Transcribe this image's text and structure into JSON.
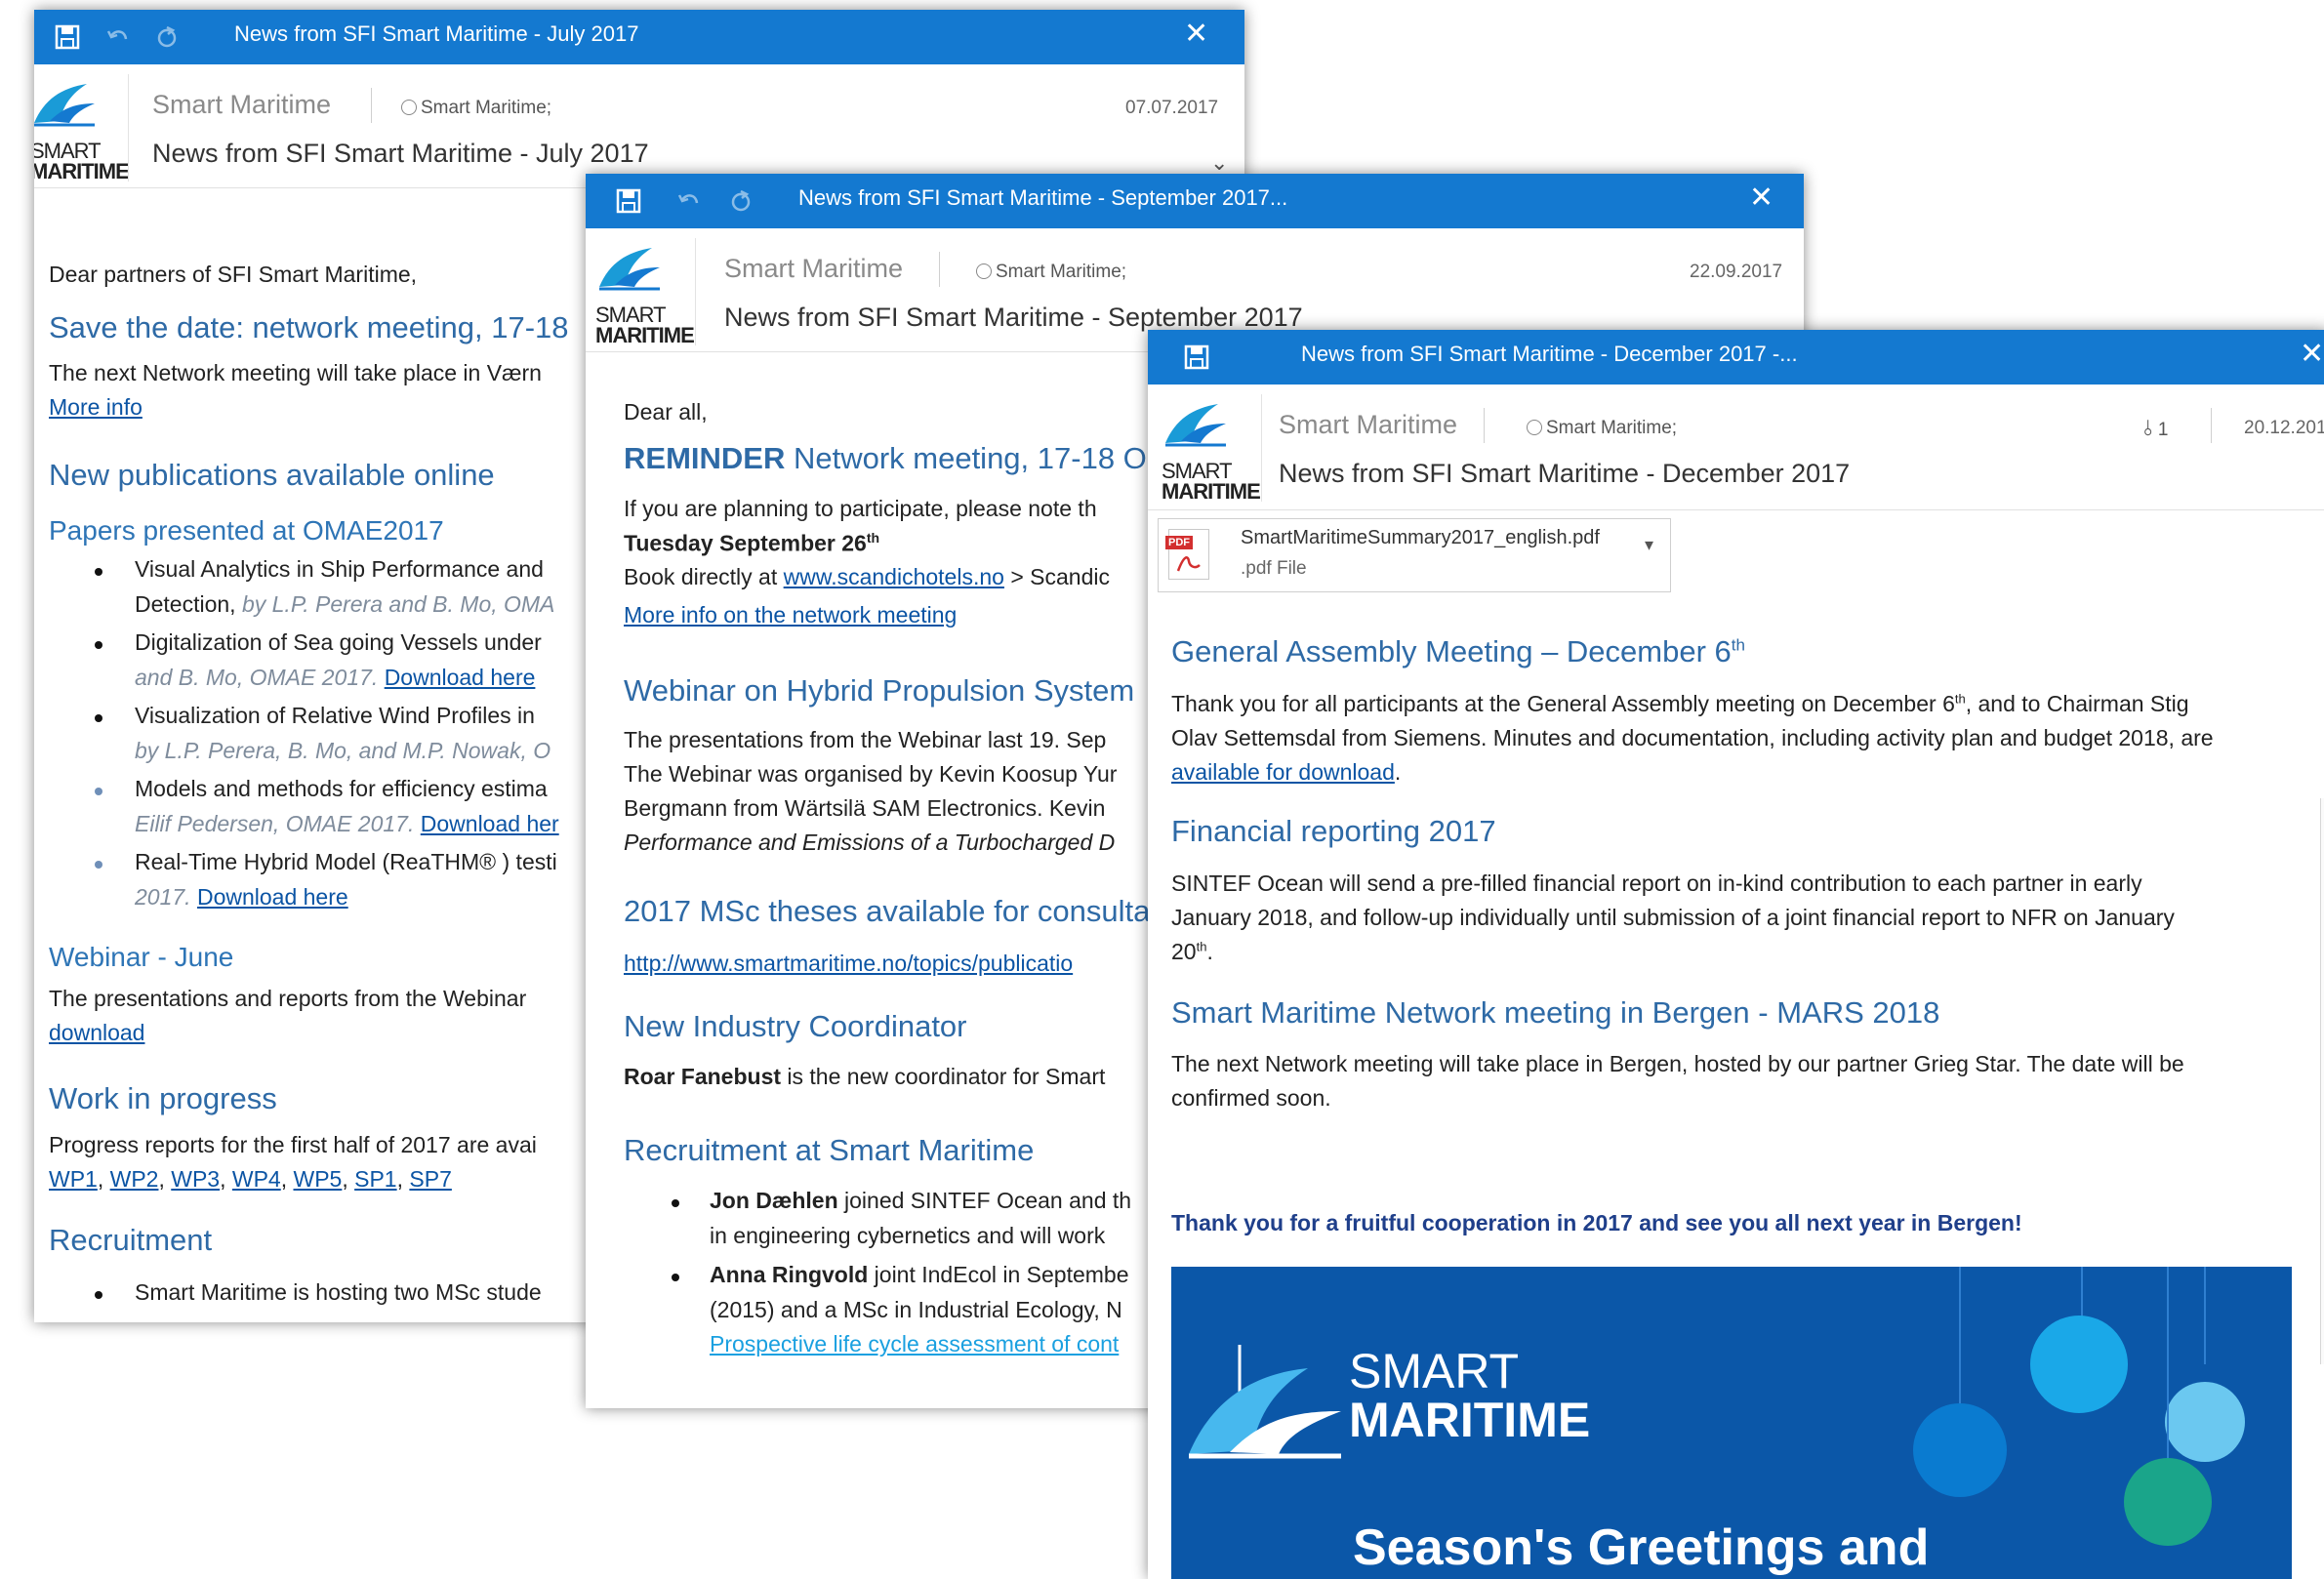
{
  "logo": {
    "line1": "SMART",
    "line2": "MARITIME"
  },
  "july": {
    "title": "News from SFI Smart Maritime - July 2017",
    "sender": "Smart Maritime",
    "to": "Smart Maritime;",
    "date": "07.07.2017",
    "subject": "News from SFI Smart Maritime - July 2017",
    "greeting": "Dear partners of SFI Smart Maritime,",
    "h_save": "Save the date: network meeting, 17-18",
    "save_text": "The next Network meeting will take place in Værn",
    "more_info": "More info",
    "h_pubs": "New publications available online",
    "h_papers": "Papers presented at OMAE2017",
    "pub1_l1": "Visual Analytics in Ship Performance and",
    "pub1_l2": "Detection,",
    "pub1_l2b": " by L.P. Perera and B. Mo, OMA",
    "pub2_l1": "Digitalization of Sea going Vessels under",
    "pub2_l2": "and B. Mo, OMAE 2017.",
    "pub3_l1": "Visualization of Relative Wind Profiles in",
    "pub3_l2": "by L.P. Perera, B. Mo, and M.P. Nowak, O",
    "pub4_l1": "Models and methods for efficiency estima",
    "pub4_l2": "Eilif Pedersen, OMAE 2017.",
    "pub5_l1": "Real-Time Hybrid Model (ReaTHM® ) testi",
    "pub5_l2": "2017.",
    "download_here": "Download here",
    "download_her": "Download her",
    "h_webinar": "Webinar - June",
    "webinar_text": "The presentations and reports from the Webinar",
    "download": "download",
    "h_work": "Work in progress",
    "work_text": "Progress reports for the first half of 2017 are avai",
    "wp_links": [
      "WP1",
      "WP2",
      "WP3",
      "WP4",
      "WP5",
      "SP1",
      "SP7"
    ],
    "h_recruit": "Recruitment",
    "recruit_text": "Smart Maritime is hosting two MSc stude"
  },
  "sept": {
    "title": "News from SFI Smart Maritime - September 2017...",
    "sender": "Smart Maritime",
    "to": "Smart Maritime;",
    "date": "22.09.2017",
    "subject": "News from SFI Smart Maritime - September 2017",
    "greeting": "Dear all,",
    "reminder": "REMINDER",
    "reminder_rest": " Network meeting, 17-18 O",
    "plan_text": "If you are planning to participate, please note th",
    "tuesday": "Tuesday September 26",
    "th": "th",
    "book_text": "Book directly at ",
    "book_link": "www.scandichotels.no",
    "book_rest": " > Scandic",
    "more_info_net": "More info on the network meeting",
    "h_hybrid": "Webinar on Hybrid Propulsion System",
    "hybrid_l1": "The presentations from the Webinar last 19. Sep",
    "hybrid_l2": "The Webinar was organised by Kevin Koosup Yur",
    "hybrid_l3": "Bergmann from Wärtsilä SAM Electronics. Kevin",
    "hybrid_l4": "Performance and Emissions of a Turbocharged D",
    "h_msc": "2017 MSc theses available for consulta",
    "msc_link": "http://www.smartmaritime.no/topics/publicatio",
    "h_coord": "New Industry Coordinator",
    "coord_name": "Roar Fanebust",
    "coord_rest": " is the new coordinator for Smart",
    "h_recruit": "Recruitment at Smart Maritime",
    "r1_name": "Jon Dæhlen",
    "r1_rest": " joined SINTEF Ocean and th",
    "r1_l2": "in engineering cybernetics and will work",
    "r2_name": "Anna Ringvold",
    "r2_rest": " joint IndEcol in Septembe",
    "r2_l2": "(2015) and a MSc in Industrial Ecology, N",
    "r2_link": "Prospective life cycle assessment of cont"
  },
  "dec": {
    "title": "News from SFI Smart Maritime - December 2017  -...",
    "sender": "Smart Maritime",
    "to": "Smart Maritime;",
    "attach_count": "1",
    "date": "20.12.201",
    "subject": "News from SFI Smart Maritime - December 2017",
    "pdf_badge": "PDF",
    "attach_name": "SmartMaritimeSummary2017_english.pdf",
    "attach_type": ".pdf File",
    "h_ga": "General Assembly Meeting – December 6",
    "th": "th",
    "ga_l1a": "Thank you for all participants at the General Assembly meeting on December 6",
    "ga_l1b": ", and to Chairman Stig",
    "ga_l2": "Olav Settemsdal from Siemens. Minutes and documentation, including activity plan and budget 2018, are",
    "ga_link": "available for download",
    "ga_dot": ".",
    "h_fin": "Financial reporting 2017",
    "fin_l1": "SINTEF Ocean will send a pre-filled financial report on in-kind contribution to each partner in early",
    "fin_l2": "January 2018, and follow-up individually until submission of a joint financial report to NFR on January",
    "fin_l3": "20",
    "fin_l3b": ".",
    "h_bergen": "Smart Maritime Network meeting in Bergen - MARS 2018",
    "bergen_l1": "The next Network meeting will take place in Bergen, hosted by our partner Grieg Star. The date will be",
    "bergen_l2": "confirmed soon.",
    "thanks": "Thank you for a fruitful cooperation in 2017 and see you all next year in Bergen!",
    "banner_smart": "SMART",
    "banner_maritime": "MARITIME",
    "greetings": "Season's Greetings and"
  },
  "colors": {
    "titlebar": "#1479d0",
    "heading": "#2e6aa6",
    "link": "#0b54a4",
    "banner": "#0b57a8"
  }
}
